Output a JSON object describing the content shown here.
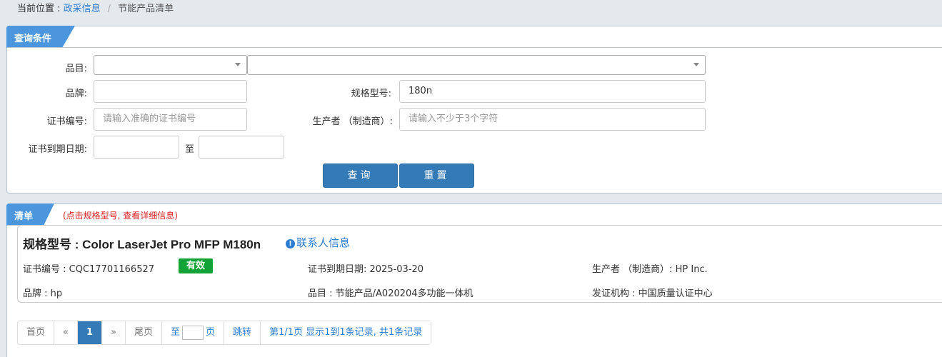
{
  "breadcrumb": {
    "prefix": "当前位置 : ",
    "link": "政采信息",
    "separator": "/",
    "current": "节能产品清单"
  },
  "query_panel": {
    "title": "查询条件",
    "category_label": "品目:",
    "category_select_1": "",
    "category_select_2": "",
    "brand_label": "品牌:",
    "brand_value": "",
    "model_label": "规格型号:",
    "model_value": "180n",
    "cert_no_label": "证书编号:",
    "cert_no_placeholder": "请输入准确的证书编号",
    "manufacturer_label": "生产者 （制造商）:",
    "manufacturer_placeholder": "请输入不少于3个字符",
    "expiry_label": "证书到期日期:",
    "expiry_from": "",
    "expiry_to_sep": "至",
    "expiry_to": "",
    "search_button": "查询",
    "reset_button": "重置"
  },
  "list_panel": {
    "title": "清单",
    "hint": "(点击规格型号, 查看详细信息)"
  },
  "result": {
    "title": "规格型号 : Color LaserJet Pro MFP M180n",
    "contact_link": "联系人信息",
    "cert_no": "证书编号 : CQC17701166527",
    "status_badge": "有效",
    "expiry": "证书到期日期: 2025-03-20",
    "manufacturer": "生产者 （制造商）: HP Inc.",
    "brand": "品牌 : hp",
    "category": "品目 : 节能产品/A020204多功能一体机",
    "issuer": "发证机构 : 中国质量认证中心"
  },
  "pagination": {
    "first": "首页",
    "prev": "«",
    "current_page": "1",
    "next": "»",
    "last": "尾页",
    "goto_prefix": "至",
    "goto_suffix": "页",
    "jump": "跳转",
    "summary": "第1/1页  显示1到1条记录, 共1条记录"
  },
  "colors": {
    "accent": "#337ab7",
    "tab_blue": "#4b96dd",
    "link": "#2b7bd1",
    "hint_red": "#dd2222",
    "badge_green": "#11a336"
  }
}
